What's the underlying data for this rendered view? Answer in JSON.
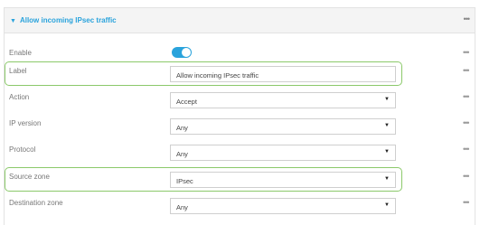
{
  "section": {
    "title": "Allow incoming IPsec traffic",
    "more": "•••"
  },
  "rows": {
    "enable": {
      "label": "Enable",
      "value": "on",
      "more": "•••"
    },
    "label": {
      "label": "Label",
      "value": "Allow incoming IPsec traffic",
      "more": "•••"
    },
    "action": {
      "label": "Action",
      "value": "Accept",
      "more": "•••"
    },
    "ip_version": {
      "label": "IP version",
      "value": "Any",
      "more": "•••"
    },
    "protocol": {
      "label": "Protocol",
      "value": "Any",
      "more": "•••"
    },
    "source_zone": {
      "label": "Source zone",
      "value": "IPsec",
      "more": "•••"
    },
    "destination_zone": {
      "label": "Destination zone",
      "value": "Any",
      "more": "•••"
    }
  },
  "colors": {
    "accent": "#2aa3dc",
    "highlight": "#8bc96a"
  },
  "icons": {
    "collapse": "caret-down-icon",
    "dropdown": "dropdown-arrow-icon",
    "more": "more-dots-icon"
  }
}
